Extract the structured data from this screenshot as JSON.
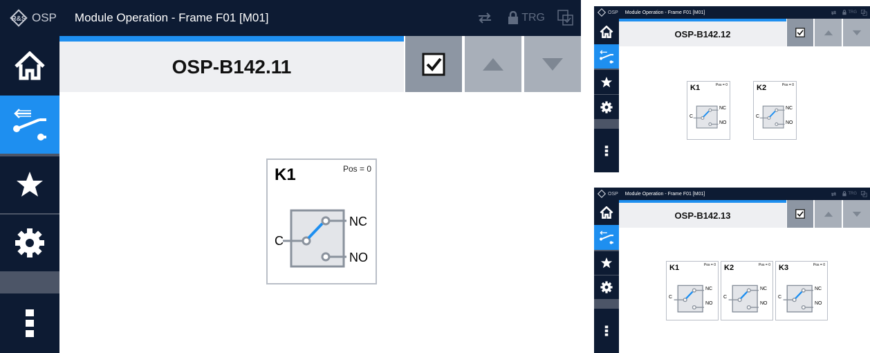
{
  "logo": {
    "text": "OSP"
  },
  "window": {
    "title": "Module Operation - Frame F01 [M01]"
  },
  "titlebar": {
    "trg_label": "TRG"
  },
  "screens": [
    {
      "module_name": "OSP-B142.11",
      "switches": [
        {
          "label": "K1",
          "pos": "Pos = 0"
        }
      ]
    },
    {
      "module_name": "OSP-B142.12",
      "switches": [
        {
          "label": "K1",
          "pos": "Pos = 0"
        },
        {
          "label": "K2",
          "pos": "Pos = 0"
        }
      ]
    },
    {
      "module_name": "OSP-B142.13",
      "switches": [
        {
          "label": "K1",
          "pos": "Pos = 0"
        },
        {
          "label": "K2",
          "pos": "Pos = 0"
        },
        {
          "label": "K3",
          "pos": "Pos = 0"
        }
      ]
    }
  ],
  "terminals": {
    "common": "C",
    "normally_closed": "NC",
    "normally_open": "NO"
  },
  "icons": {
    "nav": [
      "home-icon",
      "switch-icon",
      "star-icon",
      "gear-icon",
      "more-vertical-icon"
    ],
    "header": [
      "checkbox-icon",
      "arrow-up-icon",
      "arrow-down-icon"
    ]
  },
  "colors": {
    "titlebar": "#0d1b33",
    "accent": "#1e8ff0",
    "header_bg": "#eeeff2",
    "button": "#8d96a3",
    "card_border": "#b9bec7"
  }
}
